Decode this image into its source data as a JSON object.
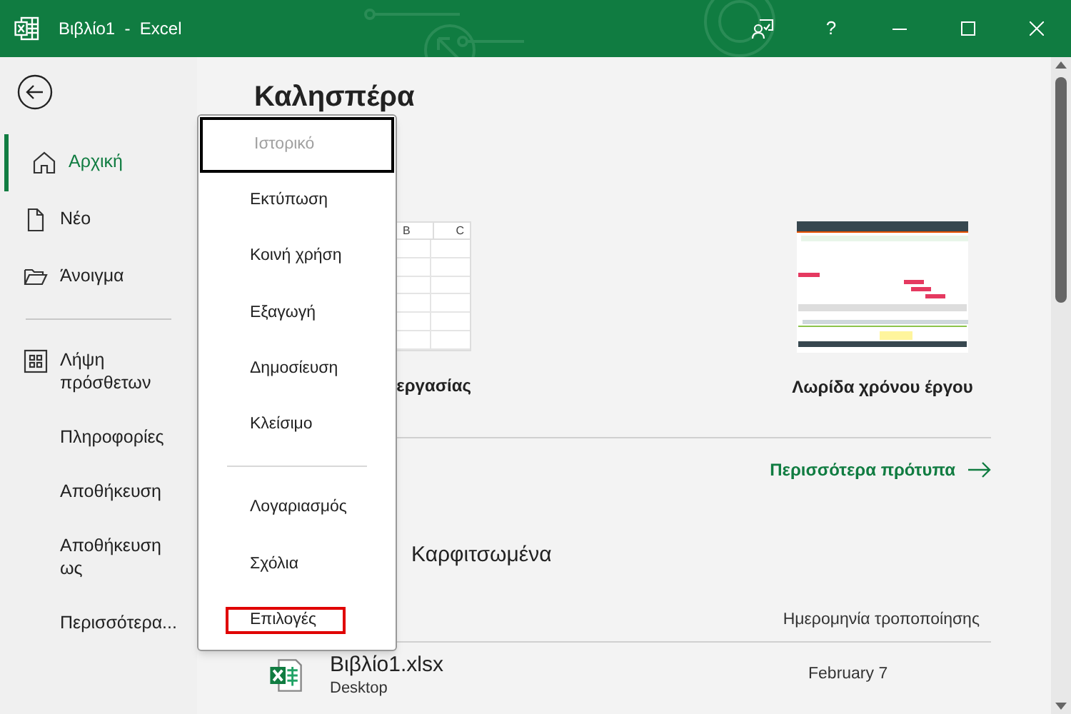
{
  "window": {
    "title": "Βιβλίο1  -  Excel",
    "help": "?"
  },
  "sidebar": {
    "items": [
      {
        "label": "Αρχική",
        "kind": "home",
        "selected": true
      },
      {
        "label": "Νέο",
        "kind": "new",
        "selected": false
      },
      {
        "label": "Άνοιγμα",
        "kind": "open",
        "selected": false
      },
      {
        "label": "Λήψη πρόσθετων",
        "kind": "addins",
        "selected": false
      },
      {
        "label": "Πληροφορίες",
        "kind": "plain",
        "selected": false
      },
      {
        "label": "Αποθήκευση",
        "kind": "plain",
        "selected": false
      },
      {
        "label": "Αποθήκευση ως",
        "kind": "plain",
        "selected": false
      },
      {
        "label": "Περισσότερα...",
        "kind": "plain",
        "selected": false
      }
    ]
  },
  "greeting": "Καλησπέρα",
  "templates": [
    {
      "kind": "sheet",
      "label": "εργασίας",
      "columns": [
        "B",
        "C"
      ]
    },
    {
      "kind": "timeline",
      "label": "Λωρίδα χρόνου έργου"
    }
  ],
  "more_templates": "Περισσότερα πρότυπα",
  "pinned": {
    "title": "Καρφιτσωμένα",
    "column_header": "Ημερομηνία τροποποίησης",
    "files": [
      {
        "name": "Βιβλίο1.xlsx",
        "location": "Desktop",
        "date": "February 7"
      }
    ]
  },
  "menu": {
    "items": [
      {
        "label": "Ιστορικό",
        "disabled": true,
        "focused": true,
        "highlighted": false
      },
      {
        "label": "Εκτύπωση",
        "disabled": false,
        "focused": false,
        "highlighted": false
      },
      {
        "label": "Κοινή χρήση",
        "disabled": false,
        "focused": false,
        "highlighted": false
      },
      {
        "label": "Εξαγωγή",
        "disabled": false,
        "focused": false,
        "highlighted": false
      },
      {
        "label": "Δημοσίευση",
        "disabled": false,
        "focused": false,
        "highlighted": false
      },
      {
        "label": "Κλείσιμο",
        "disabled": false,
        "focused": false,
        "highlighted": false,
        "divider_after": true
      },
      {
        "label": "Λογαριασμός",
        "disabled": false,
        "focused": false,
        "highlighted": false
      },
      {
        "label": "Σχόλια",
        "disabled": false,
        "focused": false,
        "highlighted": false
      },
      {
        "label": "Επιλογές",
        "disabled": false,
        "focused": false,
        "highlighted": true
      }
    ]
  }
}
